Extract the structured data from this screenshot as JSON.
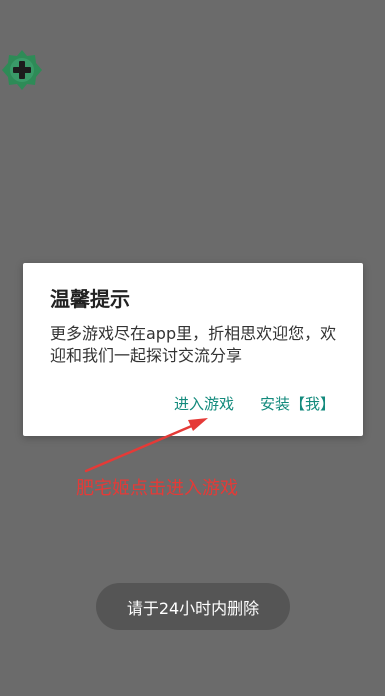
{
  "floating_button": {
    "icon": "plus-gear-icon"
  },
  "dialog": {
    "title": "温馨提示",
    "message": "更多游戏尽在app里，折相思欢迎您，欢迎和我们一起探讨交流分享",
    "enter_game_label": "进入游戏",
    "install_label": "安装【我】"
  },
  "annotation": {
    "text": "肥宅姬点击进入游戏"
  },
  "toast": {
    "text": "请于24小时内删除"
  },
  "colors": {
    "background": "#6b6b6b",
    "accent": "#138a7c",
    "annotation": "#e53a37",
    "floating_icon": "#2e8b57"
  }
}
